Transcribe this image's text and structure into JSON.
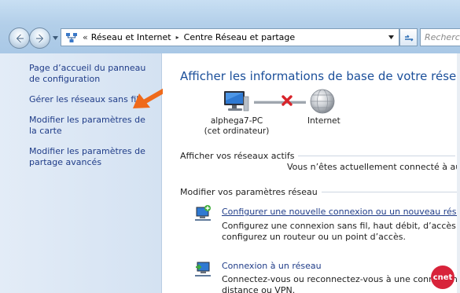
{
  "address_bar": {
    "chevron": "«",
    "crumbs": [
      "Réseau et Internet",
      "Centre Réseau et partage"
    ],
    "separator_glyph": "▸"
  },
  "search": {
    "placeholder": "Recherc"
  },
  "left_pane": {
    "links": [
      "Page d’accueil du panneau de configuration",
      "Gérer les réseaux sans fil",
      "Modifier les paramètres de la carte",
      "Modifier les paramètres de partage avancés"
    ]
  },
  "main": {
    "title": "Afficher les informations de base de votre réseau et c",
    "network_map": {
      "computer_name": "alphega7-PC",
      "computer_note": "(cet ordinateur)",
      "internet_label": "Internet"
    },
    "active_section": {
      "heading": "Afficher vos réseaux actifs",
      "message": "Vous n’êtes actuellement connecté à aucu"
    },
    "modify_section": {
      "heading": "Modifier vos paramètres réseau",
      "tasks": [
        {
          "title": "Configurer une nouvelle connexion ou un nouveau réseau",
          "desc_line1": "Configurez une connexion sans fil, haut débit, d’accès à dista",
          "desc_line2": "configurez un routeur ou un point d’accès."
        },
        {
          "title": "Connexion à un réseau",
          "desc_line1": "Connectez-vous ou reconnectez-vous à une connexion de",
          "desc_line2": "distance ou VPN."
        }
      ]
    }
  },
  "watermark": {
    "text": "cnet"
  },
  "colors": {
    "link": "#1f3c88",
    "title": "#1b4f9a",
    "arrow": "#ef6a1b",
    "error_x": "#d8232a"
  }
}
